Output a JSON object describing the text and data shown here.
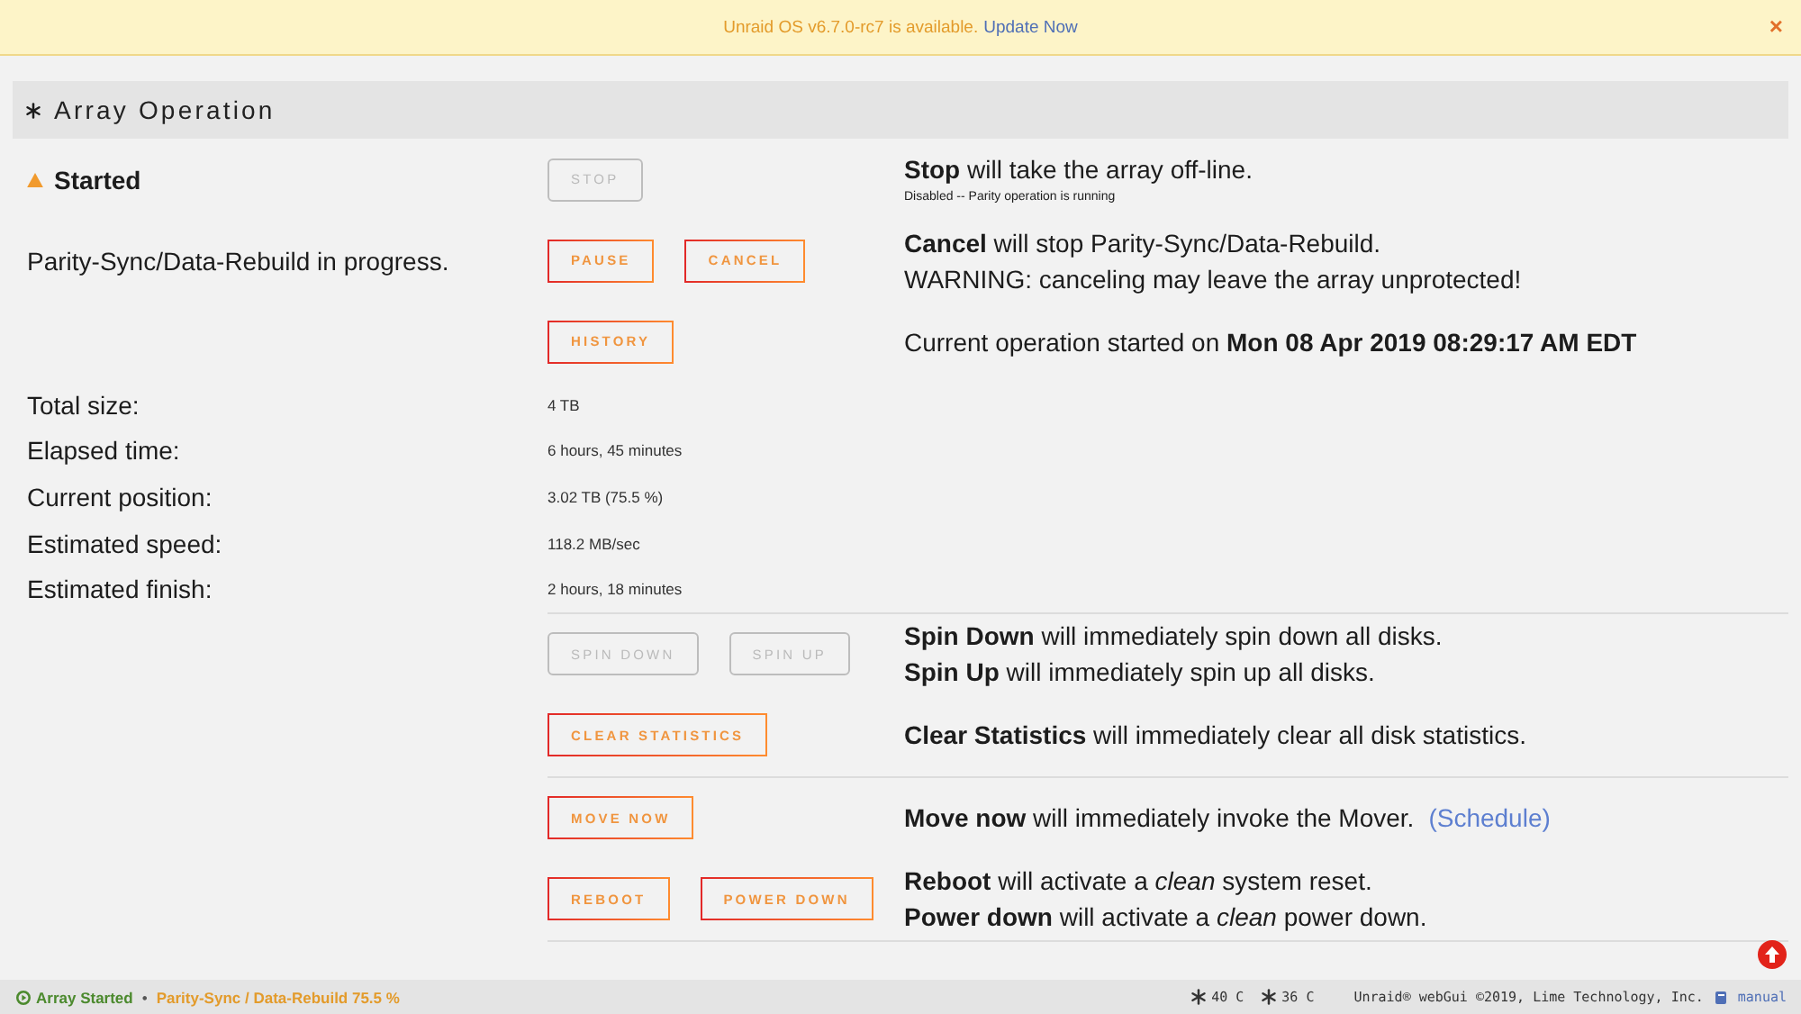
{
  "banner": {
    "message": "Unraid OS v6.7.0-rc7 is available.",
    "link": "Update Now",
    "close": "×"
  },
  "panel": {
    "title": "Array Operation",
    "rows": [
      {
        "kind": "action",
        "label": "Started",
        "warning": true,
        "buttons": [
          {
            "label": "STOP",
            "disabled": true
          }
        ],
        "lines": [
          {
            "kind": "text",
            "text": "**Stop** will take the array off-line."
          },
          {
            "kind": "note",
            "text": "Disabled -- Parity operation is running"
          }
        ]
      },
      {
        "kind": "action",
        "label": "Parity-Sync/Data-Rebuild in progress.",
        "warning": false,
        "buttons": [
          {
            "label": "PAUSE",
            "disabled": false
          },
          {
            "label": "CANCEL",
            "disabled": false
          }
        ],
        "lines": [
          {
            "kind": "text",
            "text": "**Cancel** will stop Parity-Sync/Data-Rebuild."
          },
          {
            "kind": "text",
            "text": "WARNING: canceling may leave the array unprotected!"
          }
        ]
      },
      {
        "kind": "action",
        "buttons": [
          {
            "label": "HISTORY",
            "disabled": false
          }
        ],
        "lines": [
          {
            "kind": "text",
            "text": "Current operation started on **Mon 08 Apr 2019 08:29:17 AM EDT**"
          }
        ]
      },
      {
        "kind": "stat",
        "label": "Total size:",
        "value": "4 TB"
      },
      {
        "kind": "stat",
        "label": "Elapsed time:",
        "value": "6 hours, 45 minutes"
      },
      {
        "kind": "stat",
        "label": "Current position:",
        "value": "3.02 TB (75.5 %)"
      },
      {
        "kind": "stat",
        "label": "Estimated speed:",
        "value": "118.2 MB/sec"
      },
      {
        "kind": "stat",
        "label": "Estimated finish:",
        "value": "2 hours, 18 minutes"
      },
      {
        "kind": "divider"
      },
      {
        "kind": "action",
        "buttons": [
          {
            "label": "SPIN DOWN",
            "disabled": true
          },
          {
            "label": "SPIN UP",
            "disabled": true
          }
        ],
        "lines": [
          {
            "kind": "text",
            "text": "**Spin Down** will immediately spin down all disks."
          },
          {
            "kind": "text",
            "text": "**Spin Up** will immediately spin up all disks."
          }
        ]
      },
      {
        "kind": "action",
        "buttons": [
          {
            "label": "CLEAR STATISTICS",
            "disabled": false
          }
        ],
        "lines": [
          {
            "kind": "text",
            "text": "**Clear Statistics** will immediately clear all disk statistics."
          }
        ]
      },
      {
        "kind": "divider"
      },
      {
        "kind": "action",
        "buttons": [
          {
            "label": "MOVE NOW",
            "disabled": false
          }
        ],
        "lines": [
          {
            "kind": "text",
            "text": "**Move now** will immediately invoke the Mover.",
            "link": "(Schedule)"
          }
        ]
      },
      {
        "kind": "action",
        "buttons": [
          {
            "label": "REBOOT",
            "disabled": false
          },
          {
            "label": "POWER DOWN",
            "disabled": false
          }
        ],
        "lines": [
          {
            "kind": "text",
            "text": "**Reboot** will activate a *clean* system reset."
          },
          {
            "kind": "text",
            "text": "**Power down** will activate a *clean* power down."
          }
        ]
      },
      {
        "kind": "divider"
      }
    ]
  },
  "footer": {
    "array_status": "Array Started",
    "separator": "•",
    "operation": "Parity-Sync / Data-Rebuild 75.5 %",
    "temperatures": [
      "40 C",
      "36 C"
    ],
    "copyright": "Unraid® webGui ©2019, Lime Technology, Inc.",
    "manual": "manual"
  }
}
